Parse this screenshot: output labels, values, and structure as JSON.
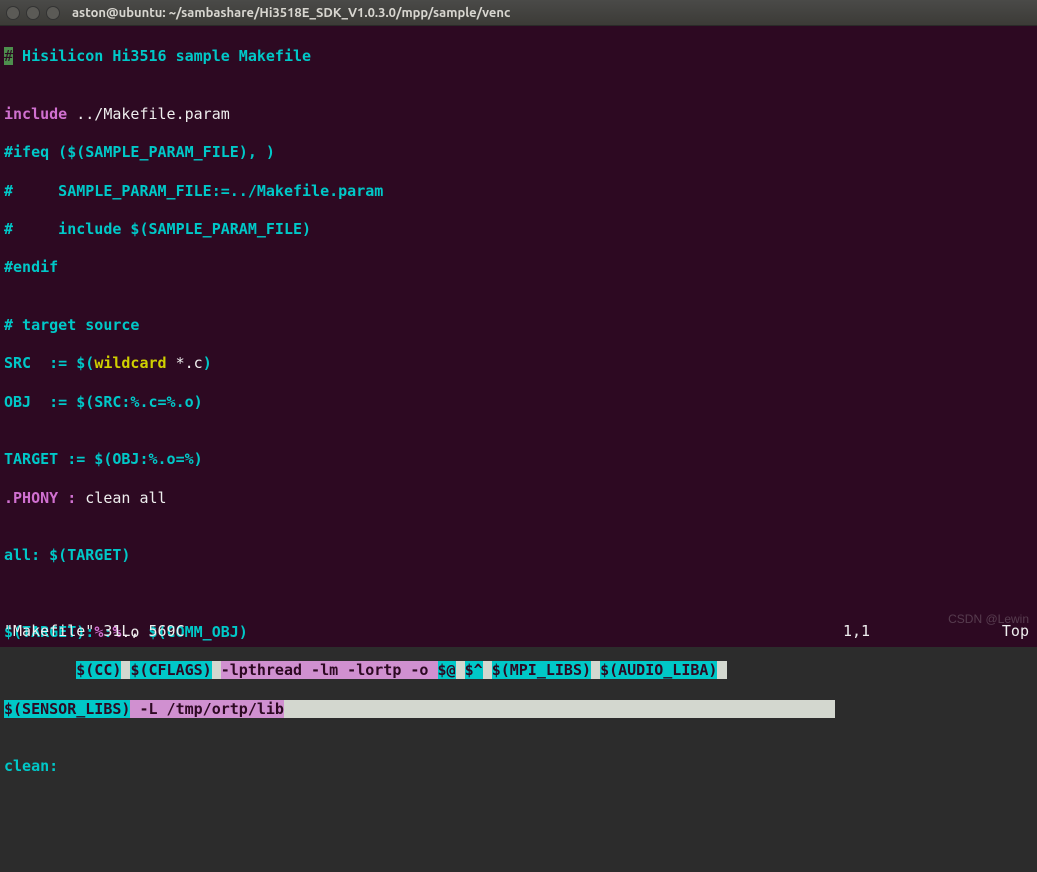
{
  "window": {
    "title": "aston@ubuntu: ~/sambashare/Hi3518E_SDK_V1.0.3.0/mpp/sample/venc"
  },
  "line01": {
    "a": "# Hisilicon Hi3516 sample Makefile"
  },
  "line02": {
    "a": ""
  },
  "line03": {
    "a": "include",
    "b": " ../Makefile.param"
  },
  "line04": {
    "a": "#ifeq ($(SAMPLE_PARAM_FILE), )"
  },
  "line05": {
    "a": "#     SAMPLE_PARAM_FILE:=../Makefile.param"
  },
  "line06": {
    "a": "#     include $(SAMPLE_PARAM_FILE)"
  },
  "line07": {
    "a": "#endif"
  },
  "line08": {
    "a": ""
  },
  "line09": {
    "a": "# target source"
  },
  "line10": {
    "a": "SRC  := $(",
    "b": "wildcard",
    "c": " *.c",
    "d": ")"
  },
  "line11": {
    "a": "OBJ  := $(SRC:%.c=%.o)"
  },
  "line12": {
    "a": ""
  },
  "line13": {
    "a": "TARGET := $(OBJ:%.o=%)"
  },
  "line14": {
    "a": ".PHONY :",
    "b": " clean all"
  },
  "line15": {
    "a": ""
  },
  "line16": {
    "a": "all:",
    "b": " $(TARGET)"
  },
  "line17": {
    "a": ""
  },
  "line18": {
    "a": ""
  },
  "line19": {
    "a": "$(TARGET):",
    "b": "%",
    "c": ":",
    "d": "%",
    "e": ".o ",
    "f": "$(COMM_OBJ)"
  },
  "line20": {
    "pre": "        ",
    "cc": "$(CC)",
    "sp1": " ",
    "cf": "$(CFLAGS)",
    "sp2": " ",
    "flags1": "-lpthread -lm -lortp -o ",
    "at": "$@",
    "sp3": " ",
    "caret": "$^",
    "sp4": " ",
    "mpi": "$(MPI_LIBS)",
    "sp5": " ",
    "aud": "$(AUDIO_LIBA)",
    "sp6": " "
  },
  "line21": {
    "sens": "$(SENSOR_LIBS)",
    "flags2": " -L /tmp/ortp/lib"
  },
  "line22": {
    "a": ""
  },
  "line23": {
    "a": "clean:"
  },
  "status": {
    "left": "\"Makefile\" 31L, 569C",
    "mid": "1,1",
    "right": "Top"
  },
  "watermark": "CSDN @Lewin"
}
